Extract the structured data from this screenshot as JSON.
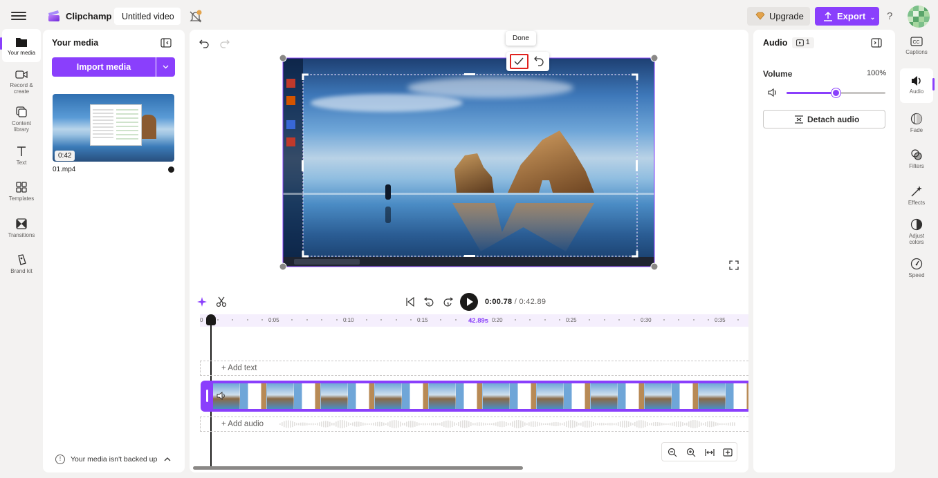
{
  "header": {
    "app_name": "Clipchamp",
    "project_title": "Untitled video",
    "upgrade_label": "Upgrade",
    "export_label": "Export",
    "help_label": "?"
  },
  "left_rail": [
    {
      "label": "Your media",
      "icon": "folder-icon"
    },
    {
      "label": "Record & create",
      "icon": "camera-icon"
    },
    {
      "label": "Content library",
      "icon": "library-icon"
    },
    {
      "label": "Text",
      "icon": "text-icon"
    },
    {
      "label": "Templates",
      "icon": "templates-icon"
    },
    {
      "label": "Transitions",
      "icon": "transitions-icon"
    },
    {
      "label": "Brand kit",
      "icon": "brand-kit-icon"
    }
  ],
  "media_panel": {
    "title": "Your media",
    "import_label": "Import media",
    "item": {
      "duration": "0:42",
      "filename": "01.mp4"
    },
    "backup_text": "Your media isn't backed up"
  },
  "preview": {
    "tooltip": "Done"
  },
  "timeline": {
    "current_time": "0:00.78",
    "separator": " / ",
    "total_time": "0:42.89",
    "hover_time": "42.89s",
    "ticks": [
      "0",
      "0:05",
      "0:10",
      "0:15",
      "0:20",
      "0:25",
      "0:30",
      "0:35"
    ],
    "add_text": "+ Add text",
    "add_audio": "+ Add audio"
  },
  "audio_panel": {
    "title": "Audio",
    "badge_count": "1",
    "volume_label": "Volume",
    "volume_value": "100%",
    "volume_level": 0.5,
    "detach_label": "Detach audio"
  },
  "right_rail": [
    {
      "label": "Captions",
      "icon": "captions-icon"
    },
    {
      "label": "Audio",
      "icon": "speaker-icon"
    },
    {
      "label": "Fade",
      "icon": "fade-icon"
    },
    {
      "label": "Filters",
      "icon": "filters-icon"
    },
    {
      "label": "Effects",
      "icon": "effects-icon"
    },
    {
      "label": "Adjust colors",
      "icon": "adjust-colors-icon"
    },
    {
      "label": "Speed",
      "icon": "speed-icon"
    }
  ],
  "colors": {
    "accent": "#8a3ffc",
    "highlight": "#e0221e"
  }
}
